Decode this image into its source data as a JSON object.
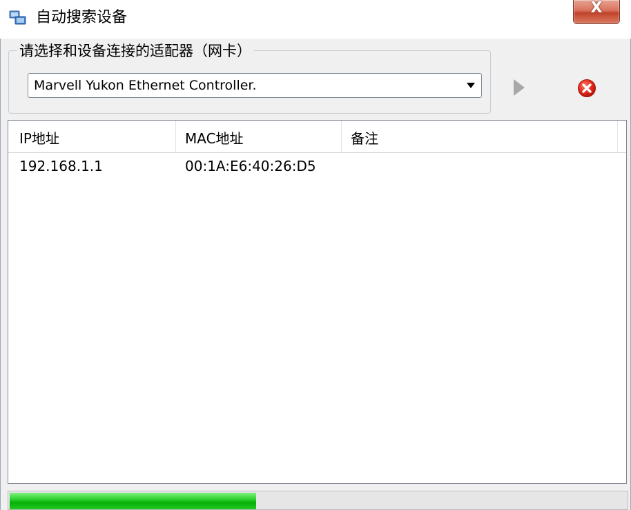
{
  "window": {
    "title": "自动搜索设备",
    "close_label": "X"
  },
  "adapter_group": {
    "legend": "请选择和设备连接的适配器（网卡）",
    "selected_adapter": "Marvell Yukon Ethernet Controller.",
    "start_icon": "play-icon",
    "stop_icon": "stop-error-icon"
  },
  "device_list": {
    "columns": [
      "IP地址",
      "MAC地址",
      "备注"
    ],
    "rows": [
      {
        "ip": "192.168.1.1",
        "mac": "00:1A:E6:40:26:D5",
        "note": ""
      }
    ]
  },
  "progress": {
    "percent": 40,
    "color": "#20c020"
  },
  "colors": {
    "close_button": "#c8432b",
    "stop_icon": "#e02020",
    "progress_green": "#20c020"
  }
}
